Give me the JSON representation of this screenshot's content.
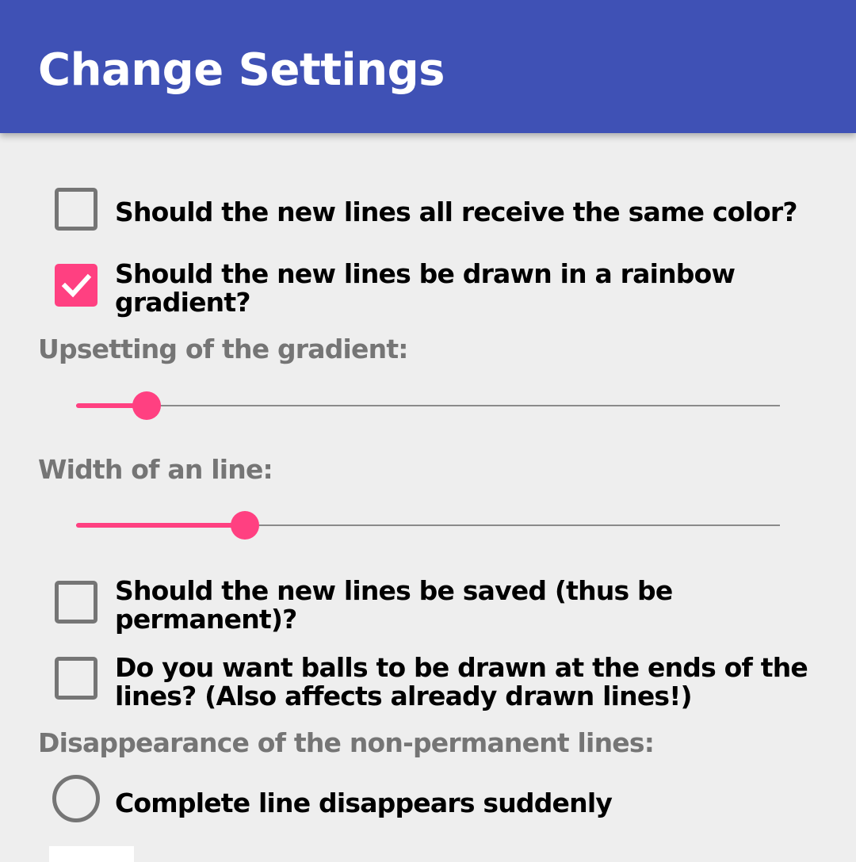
{
  "appbar": {
    "title": "Change Settings"
  },
  "options": {
    "same_color": {
      "label": "Should the new lines all receive the same color?",
      "checked": false
    },
    "rainbow": {
      "label": "Should the new lines be drawn in a rainbow gradient?",
      "checked": true
    },
    "gradient_offset": {
      "label": "Upsetting of the gradient:",
      "value": 0.1
    },
    "line_width": {
      "label": "Width of an line:",
      "value": 0.24
    },
    "saved": {
      "label": "Should the new lines be saved (thus be permanent)?",
      "checked": false
    },
    "balls": {
      "label": "Do you want balls to be drawn at the ends of the lines? (Also affects already drawn lines!)",
      "checked": false
    },
    "disappearance": {
      "label": "Disappearance of the non-permanent lines:",
      "choices": [
        {
          "label": "Complete line disappears suddenly",
          "selected": false
        }
      ]
    }
  },
  "colors": {
    "primary": "#3f51b5",
    "accent": "#ff4081",
    "background": "#eeeeee",
    "secondary_text": "#757575"
  },
  "icons": {
    "check": "check-icon"
  }
}
